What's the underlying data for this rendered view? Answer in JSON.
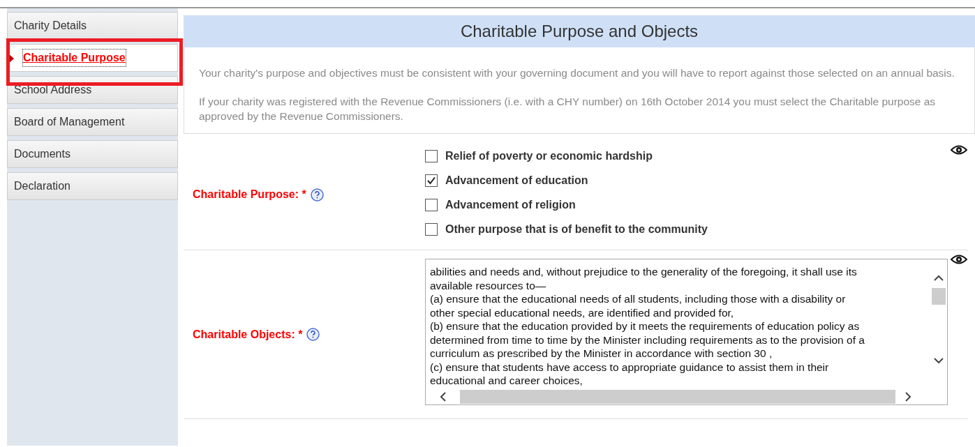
{
  "sidebar": {
    "items": [
      {
        "label": "Charity Details",
        "selected": false,
        "highlighted": false
      },
      {
        "label": "Charitable Purpose",
        "selected": true,
        "highlighted": true
      },
      {
        "label": "School Address",
        "selected": false,
        "highlighted": false
      },
      {
        "label": "Board of Management",
        "selected": false,
        "highlighted": false
      },
      {
        "label": "Documents",
        "selected": false,
        "highlighted": false
      },
      {
        "label": "Declaration",
        "selected": false,
        "highlighted": false
      }
    ]
  },
  "page_title": "Charitable Purpose and Objects",
  "info": [
    "Your charity's purpose and objectives must be consistent with your governing document and you will have to report against those selected on an annual basis.",
    "If your charity was registered with the Revenue Commissioners (i.e. with a CHY number) on 16th October 2014 you must select the Charitable purpose as approved by the Revenue Commissioners."
  ],
  "purpose": {
    "label": "Charitable Purpose:",
    "required_mark": "*",
    "options": [
      {
        "label": "Relief of poverty or economic hardship",
        "checked": false
      },
      {
        "label": "Advancement of education",
        "checked": true
      },
      {
        "label": "Advancement of religion",
        "checked": false
      },
      {
        "label": "Other purpose that is of benefit to the community",
        "checked": false
      }
    ]
  },
  "objects": {
    "label": "Charitable Objects:",
    "required_mark": "*",
    "lines": [
      "abilities and needs and, without prejudice to the generality of the foregoing, it shall use its",
      "available resources to—",
      "(a) ensure that the educational needs of all students, including those with a disability or",
      "other special educational needs, are identified and provided for,",
      "(b) ensure that the education provided by it meets the requirements of education policy as",
      "determined from time to time by the Minister including requirements as to the provision of a",
      "curriculum as prescribed by the Minister in accordance with section 30 ,",
      "(c) ensure that students have access to appropriate guidance to assist them in their",
      "educational and career choices,"
    ]
  }
}
